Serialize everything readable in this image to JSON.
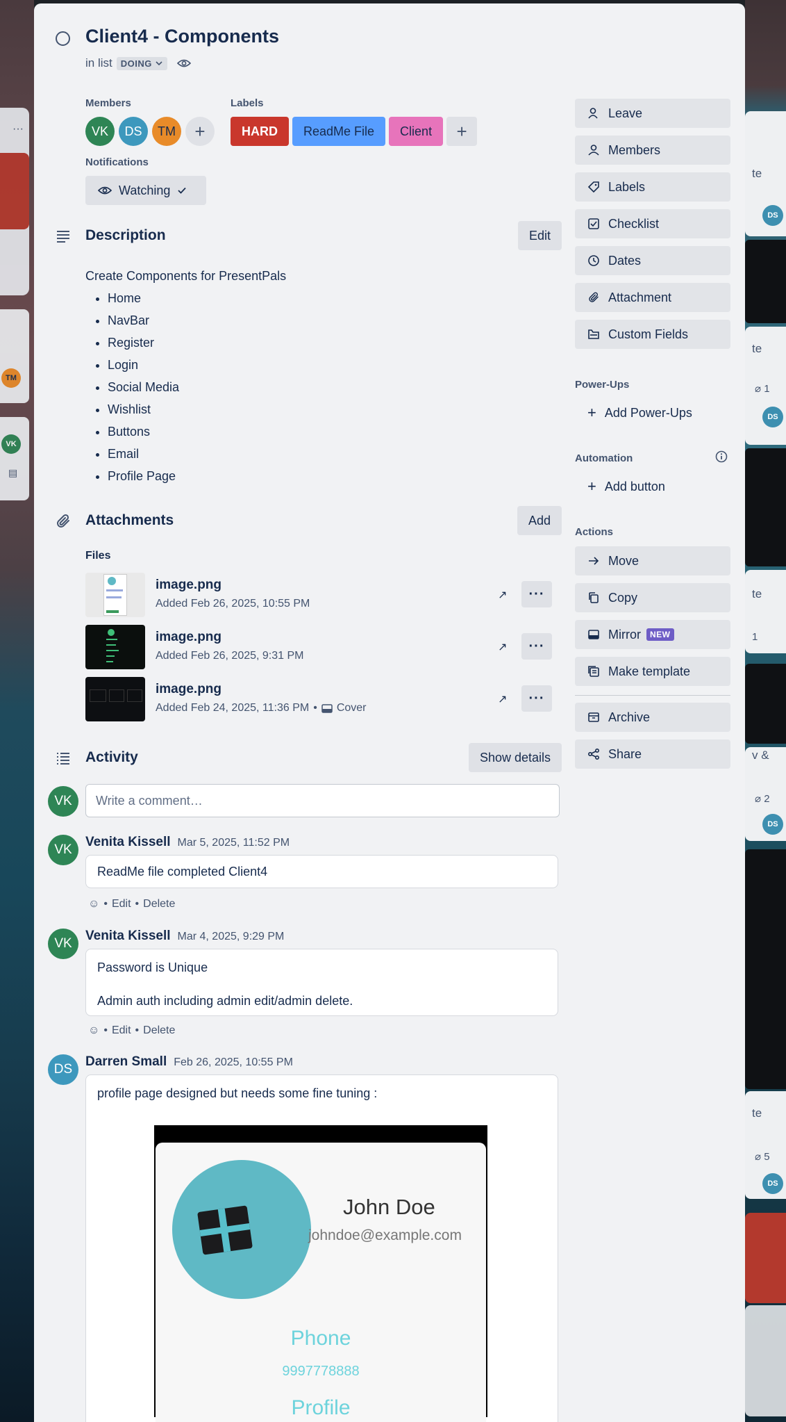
{
  "card": {
    "title": "Client4 - Components",
    "in_list_prefix": "in list",
    "list_name": "DOING"
  },
  "members": {
    "label": "Members",
    "avatars": [
      {
        "initials": "VK",
        "color": "#2e8555"
      },
      {
        "initials": "DS",
        "color": "#3d98bd"
      },
      {
        "initials": "TM",
        "color": "#e88b29"
      }
    ]
  },
  "labels": {
    "label": "Labels",
    "items": [
      {
        "text": "HARD",
        "color": "#c9372c"
      },
      {
        "text": "ReadMe File",
        "color": "#579dff"
      },
      {
        "text": "Client",
        "color": "#e774bb"
      }
    ]
  },
  "notifications": {
    "label": "Notifications",
    "button": "Watching"
  },
  "description": {
    "title": "Description",
    "edit_label": "Edit",
    "intro": "Create Components for PresentPals",
    "items": [
      "Home",
      "NavBar",
      "Register",
      "Login",
      "Social Media",
      "Wishlist",
      "Buttons",
      "Email",
      "Profile Page"
    ]
  },
  "attachments": {
    "title": "Attachments",
    "add_label": "Add",
    "files_label": "Files",
    "files": [
      {
        "name": "image.png",
        "meta": "Added Feb 26, 2025, 10:55 PM",
        "cover": ""
      },
      {
        "name": "image.png",
        "meta": "Added Feb 26, 2025, 9:31 PM",
        "cover": ""
      },
      {
        "name": "image.png",
        "meta": "Added Feb 24, 2025, 11:36 PM",
        "cover": "Cover"
      }
    ]
  },
  "activity": {
    "title": "Activity",
    "show_details": "Show details",
    "comment_placeholder": "Write a comment…",
    "current_user": "VK",
    "comments": [
      {
        "initials": "VK",
        "author": "Venita Kissell",
        "time": "Mar 5, 2025, 11:52 PM",
        "lines": [
          "ReadMe file completed Client4"
        ],
        "actions": [
          "Edit",
          "Delete"
        ]
      },
      {
        "initials": "VK",
        "author": "Venita Kissell",
        "time": "Mar 4, 2025, 9:29 PM",
        "lines": [
          "Password is Unique",
          "Admin auth including admin edit/admin delete."
        ],
        "actions": [
          "Edit",
          "Delete"
        ]
      },
      {
        "initials": "DS",
        "author": "Darren Small",
        "time": "Feb 26, 2025, 10:55 PM",
        "lines": [
          "profile page designed but needs some fine tuning :"
        ],
        "actions": []
      }
    ],
    "embedded_profile": {
      "name": "John Doe",
      "email": "johndoe@example.com",
      "phone_label": "Phone",
      "phone": "9997778888",
      "profile_label": "Profile"
    }
  },
  "sidebar": {
    "buttons": [
      "Leave",
      "Members",
      "Labels",
      "Checklist",
      "Dates",
      "Attachment",
      "Custom Fields"
    ],
    "powerups_label": "Power-Ups",
    "add_powerups": "Add Power-Ups",
    "automation_label": "Automation",
    "add_button": "Add button",
    "actions_label": "Actions",
    "actions": [
      "Move",
      "Copy",
      "Mirror",
      "Make template",
      "Archive",
      "Share"
    ],
    "mirror_badge": "NEW"
  },
  "background": {
    "left_avatars": [
      "TM",
      "VK"
    ],
    "right_card_texts": [
      "te",
      "te",
      "te",
      "v &",
      "te"
    ],
    "right_counts": [
      "1",
      "1",
      "2",
      "5"
    ],
    "right_avatar": "DS"
  }
}
